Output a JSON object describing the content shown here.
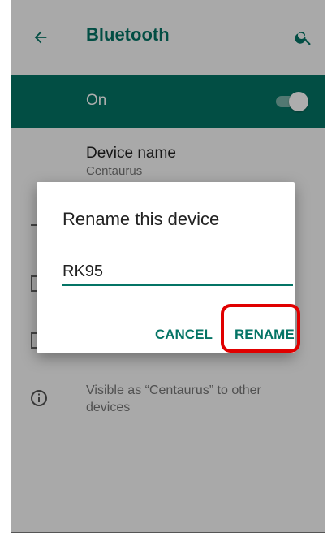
{
  "appbar": {
    "title": "Bluetooth",
    "back_icon": "arrow-left-icon",
    "search_icon": "search-icon"
  },
  "onbar": {
    "label": "On",
    "switch_on": true
  },
  "device_name": {
    "label": "Device name",
    "value": "Centaurus"
  },
  "info": {
    "icon": "info-icon",
    "text": "Visible as “Centaurus” to other devices"
  },
  "dialog": {
    "title": "Rename this device",
    "input_value": "RK95",
    "cancel_label": "CANCEL",
    "rename_label": "RENAME"
  },
  "colors": {
    "accent": "#047465",
    "highlight": "#e00000"
  }
}
